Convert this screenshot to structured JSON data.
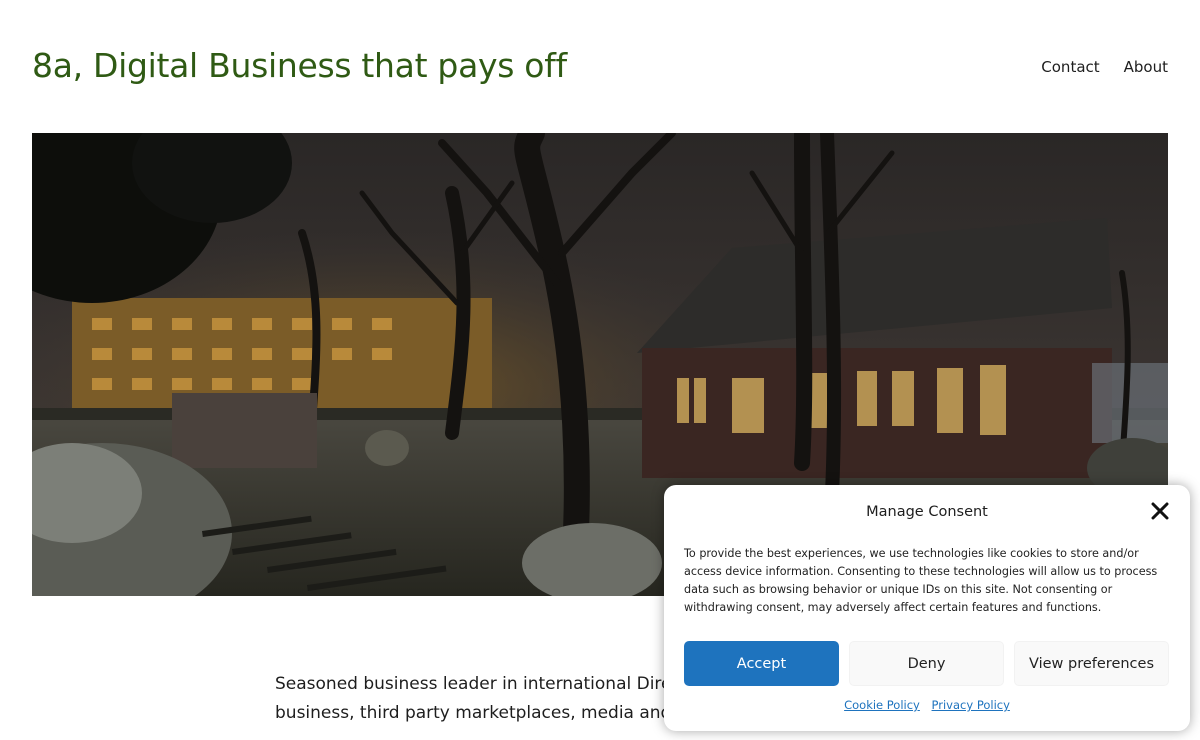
{
  "site": {
    "title": "8a, Digital Business that pays off"
  },
  "nav": {
    "items": [
      "Contact",
      "About"
    ]
  },
  "hero": {
    "image": "night-snow-house-garden-photo"
  },
  "intro": {
    "line1": "Seasoned business leader in international Direct t",
    "line2": "business, third party marketplaces, media and (in"
  },
  "consent": {
    "title": "Manage Consent",
    "close_icon": "close-icon",
    "message": "To provide the best experiences, we use technologies like cookies to store and/or access device information. Consenting to these technologies will allow us to process data such as browsing behavior or unique IDs on this site. Not consenting or withdrawing consent, may adversely affect certain features and functions.",
    "accept_label": "Accept",
    "deny_label": "Deny",
    "view_label": "View preferences",
    "cookie_policy": "Cookie Policy",
    "privacy_policy": "Privacy Policy",
    "accent_color": "#1e73be"
  },
  "colors": {
    "title": "#2f5a14",
    "accent": "#1e73be"
  }
}
